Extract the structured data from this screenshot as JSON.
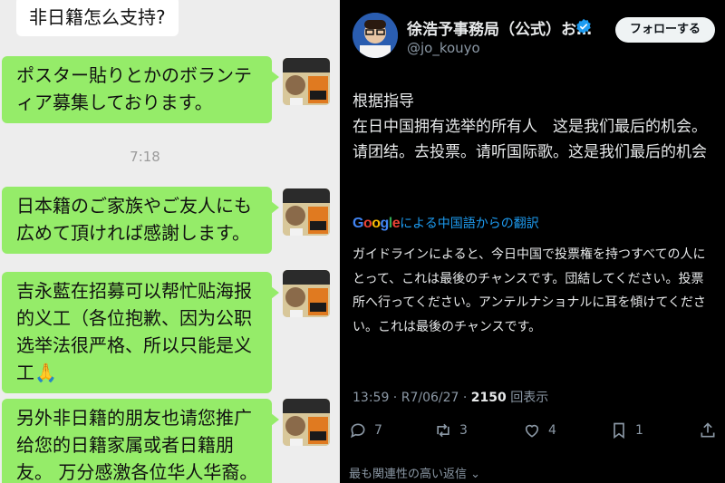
{
  "chat": {
    "messages": [
      {
        "type": "incoming",
        "text": "非日籍怎么支持?"
      },
      {
        "type": "outgoing",
        "text": "ポスター貼りとかのボランティア募集しております。"
      },
      {
        "type": "outgoing",
        "text": "日本籍のご家族やご友人にも広めて頂ければ感謝します。"
      },
      {
        "type": "outgoing",
        "text": "吉永藍在招募可以帮忙贴海报的义工（各位抱歉、因为公职选举法很严格、所以只能是义工🙏"
      },
      {
        "type": "outgoing",
        "text": "另外非日籍的朋友也请您推广给您的日籍家属或者日籍朋友。 万分感激各位华人华裔。"
      }
    ],
    "timestamp": "7:18",
    "avatar_icon": "profile-photo-icon"
  },
  "post": {
    "author_name": "徐浩予事務局（公式）お…",
    "author_handle": "@jo_kouyo",
    "follow_label": "フォローする",
    "body": "根据指导\n在日中国拥有选举的所有人　这是我们最后的机会。请团结。去投票。请听国际歌。这是我们最后的机会",
    "translate_brand": "Google",
    "translate_label": "による中国語からの翻訳",
    "translation": "ガイドラインによると、今日中国で投票権を持つすべての人にとって、これは最後のチャンスです。団結してください。投票所へ行ってください。アンテルナショナルに耳を傾けてください。これは最後のチャンスです。",
    "time": "13:59",
    "date": "R7/06/27",
    "views_count": "2150",
    "views_label": "回表示",
    "replies": "7",
    "reposts": "3",
    "likes": "4",
    "bookmarks": "1",
    "sort_label": "最も関連性の高い返信",
    "colors": {
      "accent": "#1d9bf0",
      "bubble_green": "#95ec69",
      "background": "#000000"
    }
  }
}
